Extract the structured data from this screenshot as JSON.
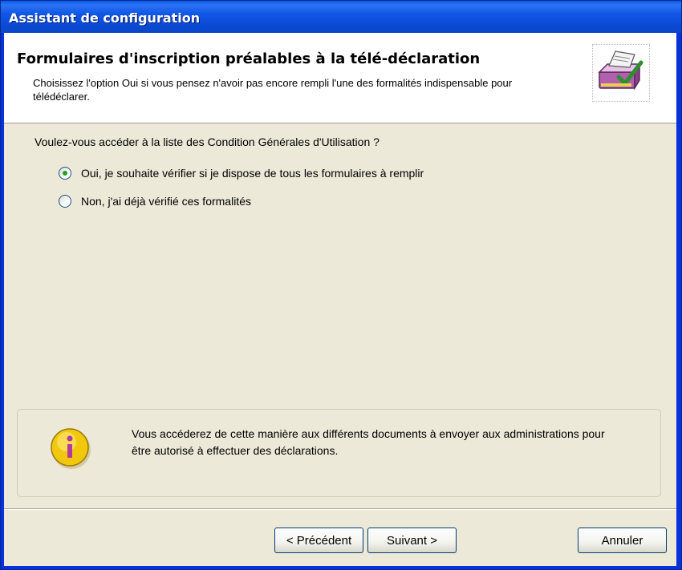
{
  "window": {
    "title": "Assistant de configuration"
  },
  "header": {
    "title": "Formulaires d'inscription préalables à la télé-déclaration",
    "description": "Choisissez l'option Oui si vous pensez n'avoir pas encore rempli l'une des formalités indispensable pour télédéclarer.",
    "icon": "printer-check-icon"
  },
  "form": {
    "question": "Voulez-vous accéder à la liste des Condition Générales d'Utilisation ?",
    "options": [
      {
        "label": "Oui, je souhaite vérifier si je dispose de tous les formulaires à remplir",
        "selected": true
      },
      {
        "label": "Non, j'ai déjà vérifié ces formalités",
        "selected": false
      }
    ]
  },
  "info": {
    "icon": "info-icon",
    "text": "Vous accéderez de cette manière aux différents documents à envoyer aux administrations pour être autorisé à effectuer des déclarations."
  },
  "buttons": {
    "previous": "< Précédent",
    "next": "Suivant >",
    "cancel": "Annuler"
  },
  "colors": {
    "titlebar": "#0a5ae8",
    "dialog_background": "#ece9d8",
    "radio_dot": "#21a121",
    "info_icon": "#f2c80f"
  }
}
